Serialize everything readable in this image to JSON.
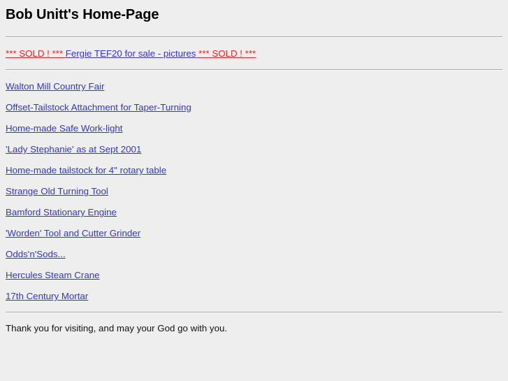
{
  "page": {
    "title": "Bob Unitt's Home-Page",
    "background_color": "#eeeeee",
    "link_color": "#3333dd",
    "alert_color": "#ff1a1a"
  },
  "featured": {
    "prefix": "*** SOLD ! *** ",
    "middle": "Fergie TEF20 for sale - pictures",
    "suffix": " *** SOLD ! ***"
  },
  "links": [
    {
      "label": "Walton Mill Country Fair"
    },
    {
      "label": "Offset-Tailstock Attachment for Taper-Turning"
    },
    {
      "label": "Home-made Safe Work-light"
    },
    {
      "label": "'Lady Stephanie' as at Sept 2001"
    },
    {
      "label": "Home-made tailstock for 4\" rotary table"
    },
    {
      "label": "Strange Old Turning Tool"
    },
    {
      "label": "Bamford Stationary Engine"
    },
    {
      "label": "'Worden' Tool and Cutter Grinder"
    },
    {
      "label": "Odds'n'Sods..."
    },
    {
      "label": "Hercules Steam Crane"
    },
    {
      "label": "17th Century Mortar"
    }
  ],
  "footer": {
    "text": "Thank you for visiting, and may your God go with you."
  }
}
